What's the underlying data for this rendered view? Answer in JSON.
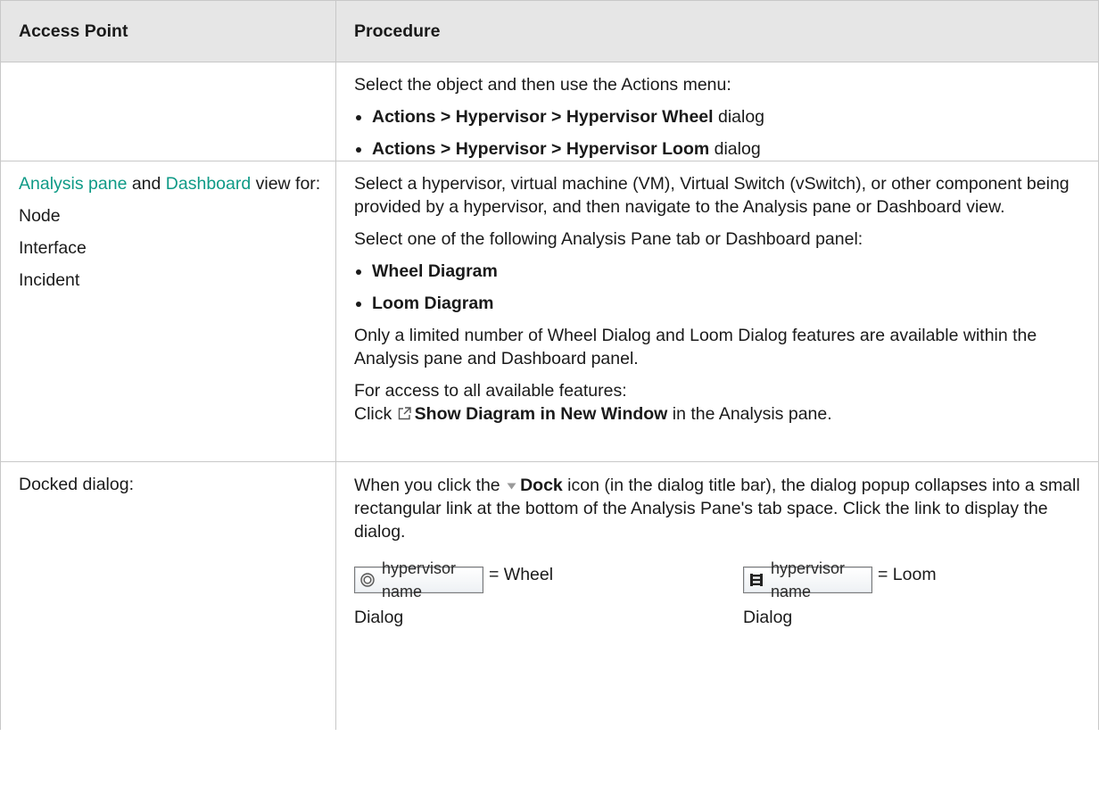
{
  "table": {
    "headers": [
      "Access Point",
      "Procedure"
    ],
    "row1": {
      "intro": "Select the object and then use the Actions menu:",
      "items": [
        {
          "bold": "Actions > Hypervisor > Hypervisor Wheel",
          "suffix": " dialog"
        },
        {
          "bold": "Actions > Hypervisor > Hypervisor Loom",
          "suffix": " dialog"
        }
      ]
    },
    "row2": {
      "access": {
        "link1": "Analysis pane",
        "and": " and ",
        "link2": "Dashboard",
        "rest": " view for:",
        "items": [
          "Node",
          "Interface",
          "Incident"
        ]
      },
      "p1": "Select a hypervisor, virtual machine (VM), Virtual Switch (vSwitch), or other component being provided by a hypervisor, and then navigate to the Analysis pane or Dashboard view.",
      "p2": "Select one of the following Analysis Pane tab or Dashboard panel:",
      "items": [
        "Wheel Diagram",
        "Loom Diagram"
      ],
      "p3": "Only a limited number of Wheel Dialog and Loom Dialog features are available within the Analysis pane and Dashboard panel.",
      "p4a": "For access to all available features:",
      "p4_click": "Click ",
      "p4_bold": "Show Diagram in New Window",
      "p4_rest": " in the Analysis pane.",
      "icon": "external-window-icon"
    },
    "row3": {
      "access": "Docked dialog:",
      "p_start": "When you click the ",
      "p_bold": "Dock",
      "p_rest": " icon (in the dialog title bar), the dialog popup collapses into a small rectangular link at the bottom of the Analysis Pane's tab space. Click the link to display the dialog.",
      "dock_icon": "dock-triangle-icon",
      "wheel_tab": "hypervisor name",
      "wheel_label": "= Wheel",
      "wheel_dialog": "Dialog",
      "loom_tab": "hypervisor name",
      "loom_label": "= Loom",
      "loom_dialog": "Dialog"
    }
  }
}
